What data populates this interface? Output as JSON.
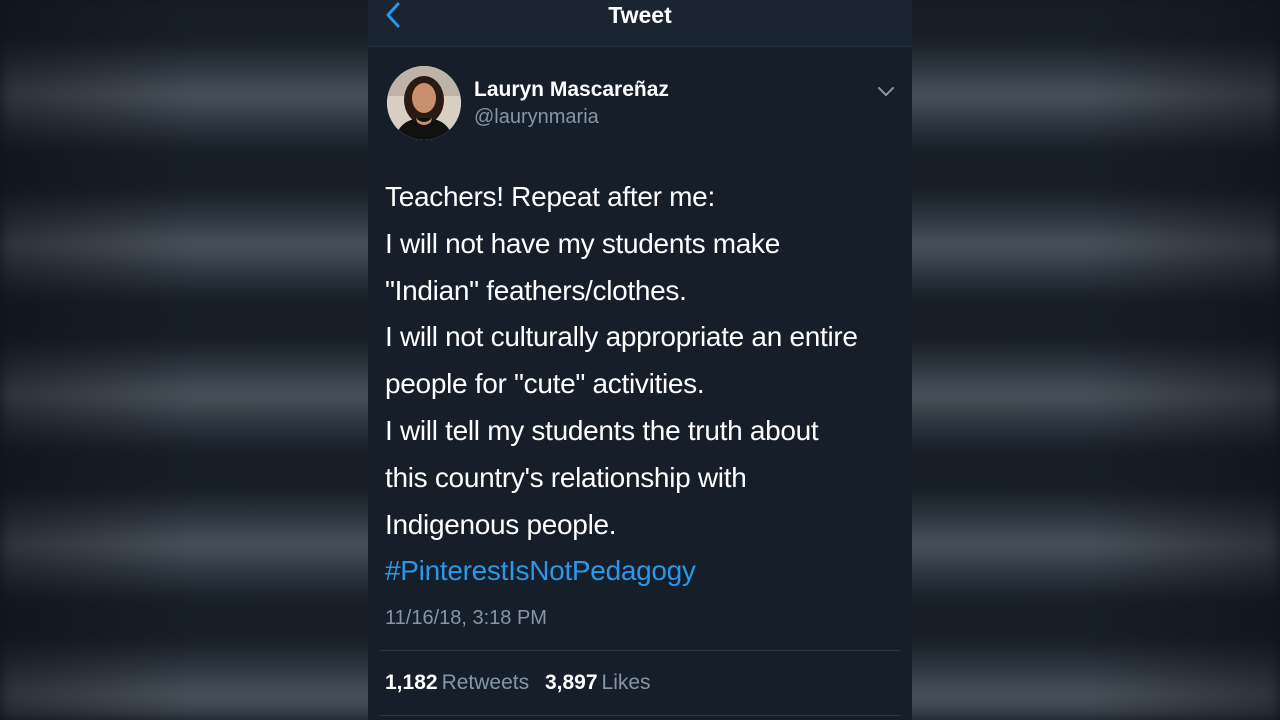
{
  "navbar": {
    "title": "Tweet",
    "back_icon": "chevron-left-icon"
  },
  "author": {
    "name": "Lauryn Mascareñaz",
    "handle": "@laurynmaria",
    "avatar_icon": "avatar"
  },
  "menu_icon": "chevron-down-icon",
  "tweet": {
    "lines": [
      "Teachers! Repeat after me:",
      "I will not have my students make",
      "\"Indian\" feathers/clothes.",
      "I will not culturally appropriate an entire",
      "people for \"cute\" activities.",
      "I will tell my students the truth about",
      "this country's relationship with",
      "Indigenous people."
    ],
    "hashtag": "#PinterestIsNotPedagogy",
    "timestamp": "11/16/18, 3:18 PM"
  },
  "stats": {
    "retweets_count": "1,182",
    "retweets_label": "Retweets",
    "likes_count": "3,897",
    "likes_label": "Likes"
  },
  "colors": {
    "background": "#141c26",
    "navbar": "#1b2532",
    "text": "#ffffff",
    "secondary_text": "#8596a8",
    "link": "#2a98e8"
  }
}
